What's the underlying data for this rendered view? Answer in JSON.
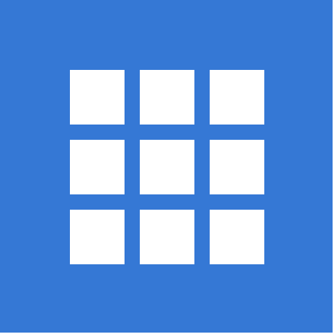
{
  "app_icon": {
    "icon_name": "grid-icon",
    "background_color": "#3578d5",
    "tile_color": "#ffffff",
    "rows": 3,
    "columns": 3
  }
}
